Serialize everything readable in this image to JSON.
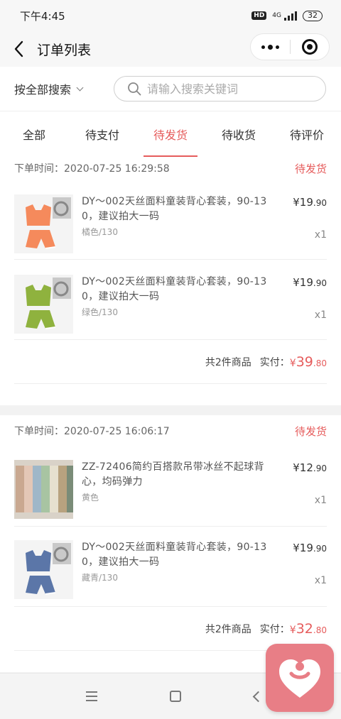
{
  "status_bar": {
    "time": "下午4:45",
    "network_badge": "HD",
    "network_type": "4G",
    "battery": "32"
  },
  "nav": {
    "title": "订单列表",
    "back_icon": "chevron-left-icon",
    "more_icon": "more-dots-icon",
    "close_icon": "target-close-icon"
  },
  "search": {
    "scope_label": "按全部搜索",
    "placeholder": "请输入搜索关键词"
  },
  "tabs": [
    {
      "label": "全部",
      "active": false
    },
    {
      "label": "待支付",
      "active": false
    },
    {
      "label": "待发货",
      "active": true
    },
    {
      "label": "待收货",
      "active": false
    },
    {
      "label": "待评价",
      "active": false
    }
  ],
  "orders": [
    {
      "time_label": "下单时间：2020-07-25 16:29:58",
      "status": "待发货",
      "items": [
        {
          "title": "DY～002天丝面料童装背心套装，90-130，建议拍大一码",
          "spec": "橘色/130",
          "price_int": "¥19",
          "price_dec": ".90",
          "qty": "x1",
          "thumb_color": "#f58a5c"
        },
        {
          "title": "DY～002天丝面料童装背心套装，90-130，建议拍大一码",
          "spec": "绿色/130",
          "price_int": "¥19",
          "price_dec": ".90",
          "qty": "x1",
          "thumb_color": "#8fb23e"
        }
      ],
      "count_label": "共2件商品",
      "paid_label": "实付：",
      "total_prefix": "¥",
      "total_int": "39",
      "total_dec": ".80"
    },
    {
      "time_label": "下单时间：2020-07-25 16:06:17",
      "status": "待发货",
      "items": [
        {
          "title": "ZZ-72406简约百搭款吊带冰丝不起球背心，均码弹力",
          "spec": "黄色",
          "price_int": "¥12",
          "price_dec": ".90",
          "qty": "x1",
          "thumb_color": "#b9a58a"
        },
        {
          "title": "DY～002天丝面料童装背心套装，90-130，建议拍大一码",
          "spec": "藏青/130",
          "price_int": "¥19",
          "price_dec": ".90",
          "qty": "x1",
          "thumb_color": "#5b76a8"
        }
      ],
      "count_label": "共2件商品",
      "paid_label": "实付：",
      "total_prefix": "¥",
      "total_int": "32",
      "total_dec": ".80"
    }
  ],
  "system_nav": {
    "menu_icon": "menu-icon",
    "home_icon": "home-icon",
    "back_icon": "back-icon"
  },
  "floating_button": {
    "icon": "heart-person-icon",
    "color": "#e87e86"
  },
  "colors": {
    "accent": "#e65c5c"
  }
}
